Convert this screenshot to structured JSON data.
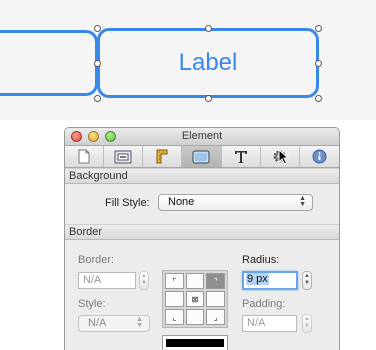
{
  "canvas": {
    "label": "Label",
    "stroke_color": "#3a88e8"
  },
  "window": {
    "title": "Element",
    "tabs": [
      {
        "name": "file-tab",
        "icon": "document-icon"
      },
      {
        "name": "layout-tab",
        "icon": "frames-icon"
      },
      {
        "name": "position-tab",
        "icon": "ruler-icon"
      },
      {
        "name": "appearance-tab",
        "icon": "box-icon",
        "active": true
      },
      {
        "name": "text-tab",
        "icon": "text-t-icon"
      },
      {
        "name": "behavior-tab",
        "icon": "gear-icon"
      },
      {
        "name": "info-tab",
        "icon": "info-icon"
      }
    ]
  },
  "background": {
    "header": "Background",
    "fill_style_label": "Fill Style:",
    "fill_style_value": "None"
  },
  "border": {
    "header": "Border",
    "border_label": "Border:",
    "border_value": "N/A",
    "style_label": "Style:",
    "style_value": "N/A",
    "radius_label": "Radius:",
    "radius_value": "9 px",
    "padding_label": "Padding:",
    "padding_value": "N/A",
    "line_color": "#000000"
  }
}
